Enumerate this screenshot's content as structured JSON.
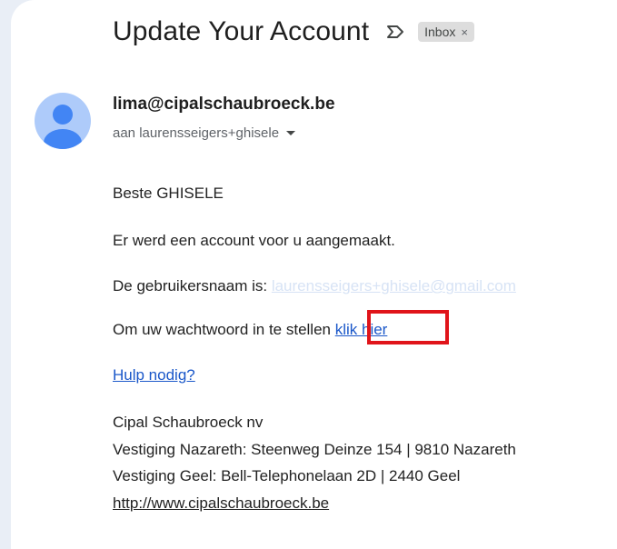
{
  "subject": "Update Your Account",
  "label_chip": {
    "text": "Inbox",
    "close": "×"
  },
  "sender": {
    "email": "lima@cipalschaubroeck.be",
    "to_line": "aan laurensseigers+ghisele"
  },
  "body": {
    "greeting": "Beste GHISELE",
    "line1": "Er werd een account voor u aangemaakt.",
    "username_prefix": "De gebruikersnaam is: ",
    "username_value": "laurensseigers+ghisele@gmail.com",
    "password_prefix": "Om uw wachtwoord in te stellen ",
    "password_link": "klik hier",
    "help_link": "Hulp nodig?"
  },
  "signature": {
    "company": "Cipal Schaubroeck nv",
    "address1": "Vestiging Nazareth: Steenweg Deinze 154 | 9810 Nazareth",
    "address2": "Vestiging Geel: Bell-Telephonelaan 2D | 2440 Geel",
    "website": "http://www.cipalschaubroeck.be"
  },
  "colors": {
    "link": "#1a57c9",
    "highlight_box": "#e0141a",
    "avatar_bg": "#aecbfa",
    "avatar_fg": "#4285f4"
  },
  "icons": {
    "label": "important-label-icon",
    "avatar": "person-avatar-icon",
    "dropdown": "chevron-down-icon"
  }
}
